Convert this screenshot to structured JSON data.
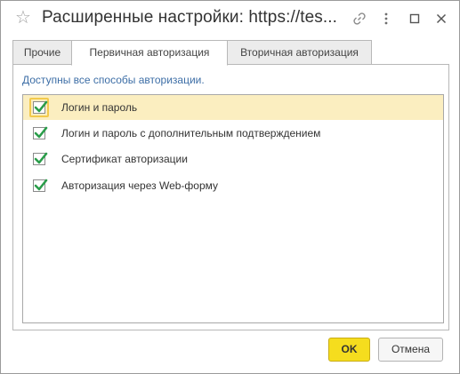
{
  "window": {
    "title": "Расширенные настройки: https://tes..."
  },
  "tabs": [
    {
      "label": "Прочие",
      "active": false
    },
    {
      "label": "Первичная авторизация",
      "active": true
    },
    {
      "label": "Вторичная авторизация",
      "active": false
    }
  ],
  "panel": {
    "info_text": "Доступны все способы авторизации.",
    "items": [
      {
        "label": "Логин и пароль",
        "checked": true,
        "selected": true
      },
      {
        "label": "Логин и пароль с дополнительным подтверждением",
        "checked": true,
        "selected": false
      },
      {
        "label": "Сертификат авторизации",
        "checked": true,
        "selected": false
      },
      {
        "label": "Авторизация через Web-форму",
        "checked": true,
        "selected": false
      }
    ]
  },
  "buttons": {
    "ok_label": "OK",
    "cancel_label": "Отмена"
  },
  "colors": {
    "accent_ok": "#f5dd1e",
    "selected_row": "#fbeec0",
    "check_green": "#2a9d4a",
    "info_text": "#3d6ea6"
  },
  "icons": [
    "star-icon",
    "link-icon",
    "more-vertical-icon",
    "maximize-icon",
    "close-icon",
    "checkmark-icon"
  ]
}
